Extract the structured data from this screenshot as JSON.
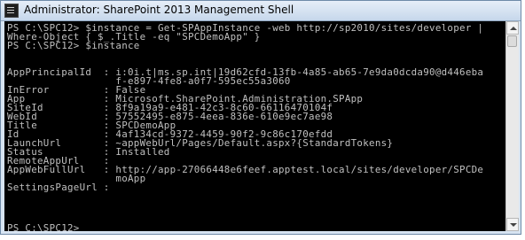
{
  "window": {
    "title": "Administrator: SharePoint 2013 Management Shell"
  },
  "icons": {
    "window_icon": "powershell-icon",
    "scroll_up": "arrow-up-icon",
    "scroll_down": "arrow-down-icon"
  },
  "colors": {
    "console_bg": "#000000",
    "console_text": "#c0c0c0"
  },
  "console": {
    "lines": [
      "PS C:\\SPC12> $instance = Get-SPAppInstance -web http://sp2010/sites/developer |",
      "Where-Object { $_.Title -eq \"SPCDemoApp\" }",
      "PS C:\\SPC12> $instance",
      "",
      "",
      "AppPrincipalId  : i:0i.t|ms.sp.int|19d62cfd-13fb-4a85-ab65-7e9da0dcda90@d446eba",
      "                  f-e897-4fe8-a0f7-595ec55a3060",
      "InError         : False",
      "App             : Microsoft.SharePoint.Administration.SPApp",
      "SiteId          : 8f9a19a9-e481-42c3-8c60-66116470104f",
      "WebId           : 57552495-e875-4eea-836e-610e9ec7ae98",
      "Title           : SPCDemoApp",
      "Id              : 4af134cd-9372-4459-90f2-9c86c170efdd",
      "LaunchUrl       : ~appWebUrl/Pages/Default.aspx?{StandardTokens}",
      "Status          : Installed",
      "RemoteAppUrl    :",
      "AppWebFullUrl   : http://app-27066448e6feef.apptest.local/sites/developer/SPCDe",
      "                  moApp",
      "SettingsPageUrl :",
      "",
      "",
      "",
      "PS C:\\SPC12> "
    ]
  }
}
